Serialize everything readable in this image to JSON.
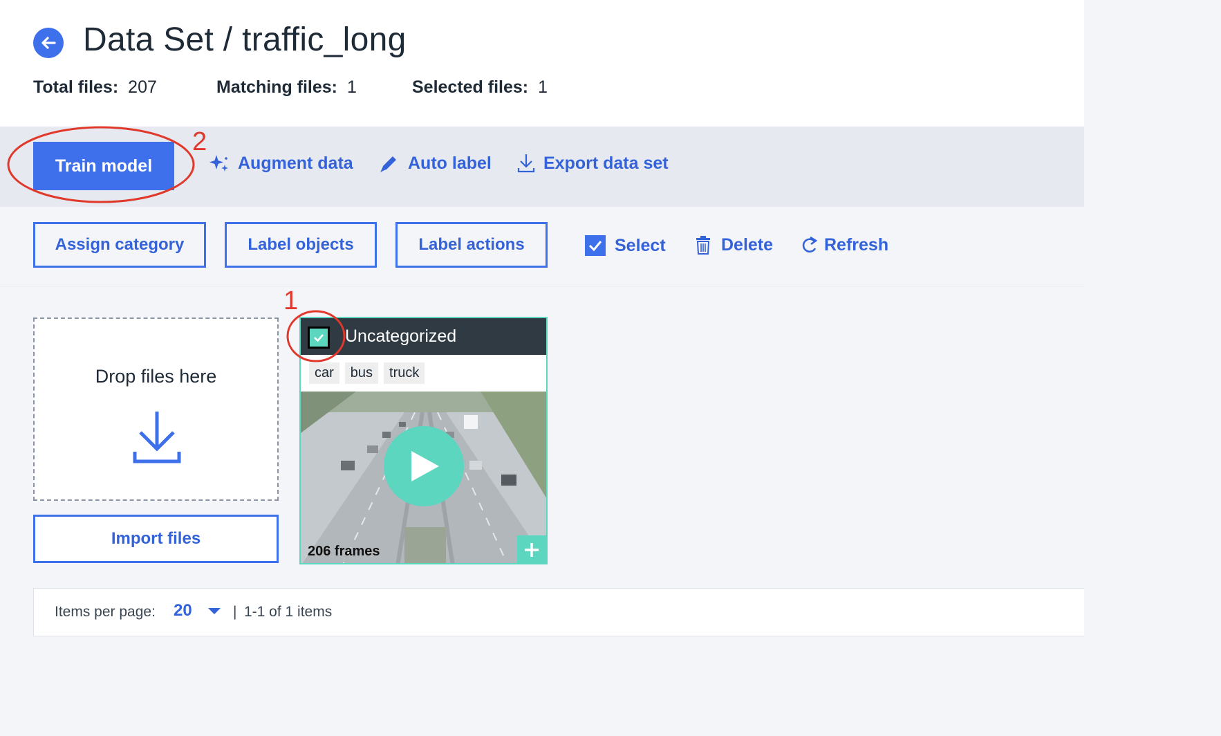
{
  "header": {
    "title": "Data Set / traffic_long",
    "stats": {
      "total_label": "Total files:",
      "total_value": "207",
      "matching_label": "Matching files:",
      "matching_value": "1",
      "selected_label": "Selected files:",
      "selected_value": "1"
    }
  },
  "toolbar": {
    "train_model": "Train model",
    "augment_data": "Augment data",
    "auto_label": "Auto label",
    "export_data_set": "Export data set"
  },
  "actions": {
    "assign_category": "Assign category",
    "label_objects": "Label objects",
    "label_actions": "Label actions",
    "select": "Select",
    "delete": "Delete",
    "refresh": "Refresh"
  },
  "dropzone": {
    "text": "Drop files here",
    "import_button": "Import files"
  },
  "card": {
    "category": "Uncategorized",
    "tags": [
      "car",
      "bus",
      "truck"
    ],
    "frames": "206 frames",
    "selected": true
  },
  "pagination": {
    "items_per_page_label": "Items per page:",
    "items_per_page_value": "20",
    "separator": "|",
    "range_text": "1-1 of 1 items"
  },
  "annotations": {
    "marker_1": "1",
    "marker_2": "2"
  },
  "colors": {
    "primary": "#3d70ea",
    "link": "#3462d8",
    "accent_teal": "#5dd6c0",
    "annotation_red": "#e0392b",
    "card_header": "#2f3a43"
  },
  "icons": [
    "back-arrow-icon",
    "sparkle-icon",
    "pencil-icon",
    "download-icon",
    "checkbox-checked-icon",
    "trash-icon",
    "refresh-icon",
    "play-icon",
    "plus-icon",
    "chevron-down-icon"
  ]
}
